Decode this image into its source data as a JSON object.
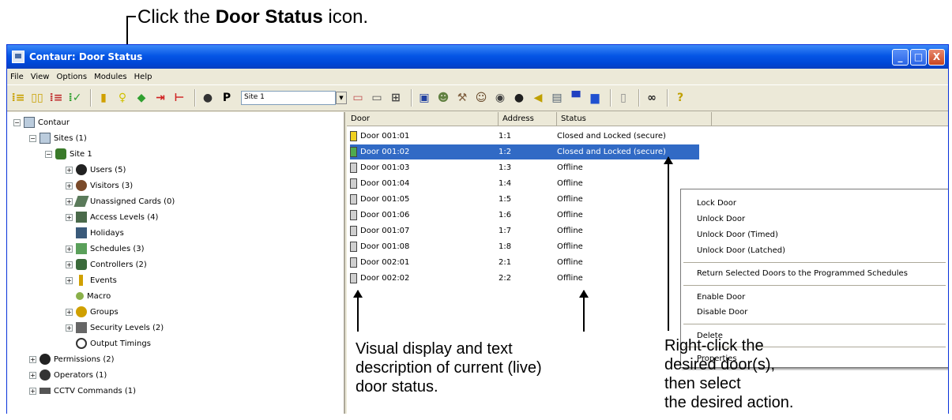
{
  "callout_top": {
    "prefix": "Click the ",
    "bold": "Door Status",
    "suffix": " icon."
  },
  "window": {
    "title": "Contaur: Door Status"
  },
  "title_buttons": {
    "minimize": "_",
    "maximize": "□",
    "close": "X"
  },
  "menu": [
    "File",
    "View",
    "Options",
    "Modules",
    "Help"
  ],
  "toolbar": {
    "site_value": "Site 1",
    "p_label": "P"
  },
  "tree": [
    {
      "label": "Contaur",
      "depth": 0,
      "expander": "−",
      "icon": "computer-icon"
    },
    {
      "label": "Sites (1)",
      "depth": 1,
      "expander": "−",
      "icon": "computer-icon"
    },
    {
      "label": "Site 1",
      "depth": 2,
      "expander": "−",
      "icon": "site-icon"
    },
    {
      "label": "Users (5)",
      "depth": 3,
      "expander": "+",
      "icon": "users-icon"
    },
    {
      "label": "Visitors (3)",
      "depth": 3,
      "expander": "+",
      "icon": "visitors-icon"
    },
    {
      "label": "Unassigned Cards (0)",
      "depth": 3,
      "expander": "+",
      "icon": "card-icon"
    },
    {
      "label": "Access Levels (4)",
      "depth": 3,
      "expander": "+",
      "icon": "access-levels-icon"
    },
    {
      "label": "Holidays",
      "depth": 3,
      "expander": "",
      "icon": "holidays-icon"
    },
    {
      "label": "Schedules (3)",
      "depth": 3,
      "expander": "+",
      "icon": "schedules-icon"
    },
    {
      "label": "Controllers (2)",
      "depth": 3,
      "expander": "+",
      "icon": "controllers-icon"
    },
    {
      "label": "Events",
      "depth": 3,
      "expander": "+",
      "icon": "events-icon"
    },
    {
      "label": "Macro",
      "depth": 3,
      "expander": "",
      "icon": "macro-icon"
    },
    {
      "label": "Groups",
      "depth": 3,
      "expander": "+",
      "icon": "groups-icon"
    },
    {
      "label": "Security Levels (2)",
      "depth": 3,
      "expander": "+",
      "icon": "security-levels-icon"
    },
    {
      "label": "Output Timings",
      "depth": 3,
      "expander": "",
      "icon": "output-timings-icon"
    },
    {
      "label": "Permissions (2)",
      "depth": 1,
      "expander": "+",
      "icon": "permissions-icon"
    },
    {
      "label": "Operators (1)",
      "depth": 1,
      "expander": "+",
      "icon": "operators-icon"
    },
    {
      "label": "CCTV Commands (1)",
      "depth": 1,
      "expander": "+",
      "icon": "cctv-icon"
    }
  ],
  "list": {
    "columns": [
      "Door",
      "Address",
      "Status"
    ],
    "rows": [
      {
        "door": "Door 001:01",
        "address": "1:1",
        "status": "Closed and Locked (secure)",
        "state": "yellow"
      },
      {
        "door": "Door 001:02",
        "address": "1:2",
        "status": "Closed and Locked (secure)",
        "state": "green"
      },
      {
        "door": "Door 001:03",
        "address": "1:3",
        "status": "Offline",
        "state": "grey"
      },
      {
        "door": "Door 001:04",
        "address": "1:4",
        "status": "Offline",
        "state": "grey"
      },
      {
        "door": "Door 001:05",
        "address": "1:5",
        "status": "Offline",
        "state": "grey"
      },
      {
        "door": "Door 001:06",
        "address": "1:6",
        "status": "Offline",
        "state": "grey"
      },
      {
        "door": "Door 001:07",
        "address": "1:7",
        "status": "Offline",
        "state": "grey"
      },
      {
        "door": "Door 001:08",
        "address": "1:8",
        "status": "Offline",
        "state": "grey"
      },
      {
        "door": "Door 002:01",
        "address": "2:1",
        "status": "Offline",
        "state": "grey"
      },
      {
        "door": "Door 002:02",
        "address": "2:2",
        "status": "Offline",
        "state": "grey"
      }
    ],
    "selected_index": 1
  },
  "context_menu": {
    "groups": [
      [
        "Lock Door",
        "Unlock Door",
        "Unlock Door (Timed)",
        "Unlock Door (Latched)"
      ],
      [
        "Return Selected Doors to the Programmed Schedules"
      ],
      [
        "Enable Door",
        "Disable Door"
      ],
      [
        "Delete"
      ],
      [
        "Properties"
      ]
    ]
  },
  "annotation_left": [
    "Visual display and text",
    "description of current (live)",
    "door status."
  ],
  "annotation_right": [
    "Right-click the",
    "desired door(s),",
    "then select",
    "the desired action."
  ]
}
